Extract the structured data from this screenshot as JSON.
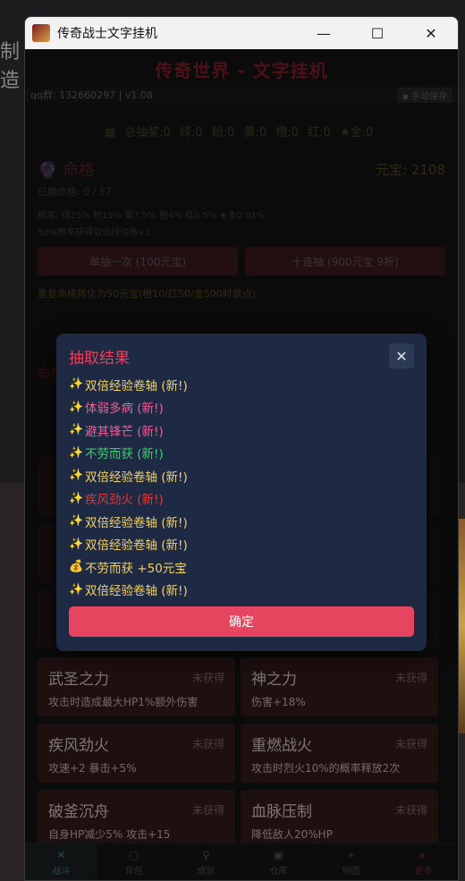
{
  "desktop": {
    "side_text": "制造"
  },
  "window": {
    "title": "传奇战士文字挂机"
  },
  "app": {
    "game_title": "传奇世界 - 文字挂机",
    "qq_info": "qq群: 132660297 | v1.08",
    "save_label": "手动保存",
    "stats": [
      "总抽奖:0",
      "绿:0",
      "粉:0",
      "黄:0",
      "橙:0",
      "红:0",
      "★金:0"
    ],
    "fate": {
      "title": "命格",
      "yuanbao": "元宝: 2108",
      "owned": "已拥命格: 0 / 57",
      "rates": "概率: 绿25% 粉15% 黄7.5% 橙4% 红0.5% ★金0.01%",
      "double": "50%概率获得双倍经验卷×1",
      "single_draw": "单抽一次 (100元宝)",
      "ten_draw": "十连抽 (900元宝 9折)",
      "convert": "重复命格转化为50元宝(橙10/红50/金500时装点)"
    },
    "category_label": "命格",
    "cards": [
      {
        "name": "武圣之力",
        "status": "未获得",
        "desc": "攻击时造成最大HP1%额外伤害"
      },
      {
        "name": "神之力",
        "status": "未获得",
        "desc": "伤害+18%"
      },
      {
        "name": "疾风劲火",
        "status": "未获得",
        "desc": "攻速+2 暴击+5%"
      },
      {
        "name": "重燃战火",
        "status": "未获得",
        "desc": "攻击时烈火10%的概率释放2次"
      },
      {
        "name": "破釜沉舟",
        "status": "未获得",
        "desc": "自身HP减少5% 攻击+15"
      },
      {
        "name": "血脉压制",
        "status": "未获得",
        "desc": "降低敌人20%HP"
      }
    ],
    "nav": [
      {
        "label": "战斗",
        "icon": "✕"
      },
      {
        "label": "背包",
        "icon": "▢"
      },
      {
        "label": "成就",
        "icon": "♀"
      },
      {
        "label": "仓库",
        "icon": "▣"
      },
      {
        "label": "地图",
        "icon": "⌖"
      },
      {
        "label": "更多",
        "icon": "▸"
      }
    ]
  },
  "modal": {
    "title": "抽取结果",
    "confirm_label": "确定",
    "results": [
      {
        "icon": "✨",
        "text": "双倍经验卷轴 (新!)",
        "color": "#f2d16b"
      },
      {
        "icon": "✨",
        "text": "体弱多病 (新!)",
        "color": "#e8609a"
      },
      {
        "icon": "✨",
        "text": "避其锋芒 (新!)",
        "color": "#e8609a"
      },
      {
        "icon": "✨",
        "text": "不劳而获 (新!)",
        "color": "#3fcf6f"
      },
      {
        "icon": "✨",
        "text": "双倍经验卷轴 (新!)",
        "color": "#f2d16b"
      },
      {
        "icon": "✨",
        "text": "疾风劲火 (新!)",
        "color": "#e23838"
      },
      {
        "icon": "✨",
        "text": "双倍经验卷轴 (新!)",
        "color": "#f2d16b"
      },
      {
        "icon": "✨",
        "text": "双倍经验卷轴 (新!)",
        "color": "#f2d16b"
      },
      {
        "icon": "💰",
        "text": "不劳而获 +50元宝",
        "color": "#f2d16b"
      },
      {
        "icon": "✨",
        "text": "双倍经验卷轴 (新!)",
        "color": "#f2d16b"
      }
    ]
  }
}
